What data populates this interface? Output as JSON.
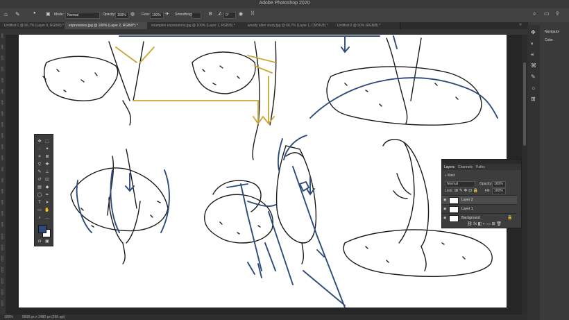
{
  "app": {
    "title": "Adobe Photoshop 2020"
  },
  "options": {
    "mode_label": "Mode:",
    "mode_value": "Normal",
    "opacity_label": "Opacity:",
    "opacity_value": "100%",
    "flow_label": "Flow:",
    "flow_value": "100%",
    "smoothing_label": "Smoothing:",
    "angle_value": "0°"
  },
  "tabs": [
    {
      "label": "Untitled-1 @ 66,7% (Layer 8, RGB/8) *"
    },
    {
      "label": "expressions.jpg @ 100% (Layer 2, RGB/8*) *"
    },
    {
      "label": "examples expressions.jpg @ 100% (Layer 1, RGB/8) *"
    },
    {
      "label": "woody allen study.jpg @ 66,7% (Layer 1, CMYK/8) *"
    },
    {
      "label": "Untitled-2 @ 50% (RGB/8) *"
    }
  ],
  "ruler_left": [
    "100",
    "150",
    "200",
    "250",
    "300",
    "350",
    "400",
    "450",
    "500",
    "550",
    "600",
    "650",
    "700",
    "750",
    "800",
    "850",
    "900",
    "950",
    "1000",
    "1050",
    "1100",
    "1150",
    "1200",
    "1250",
    "1300"
  ],
  "status": {
    "zoom": "100%",
    "doc_size": "5608 px x 2480 px (300 ppi)"
  },
  "right_panels": {
    "navigator": "Navigator",
    "color": "Color"
  },
  "layers_panel": {
    "tabs": [
      "Layers",
      "Channels",
      "Paths"
    ],
    "kind": "Kind",
    "blend": "Normal",
    "opacity_label": "Opacity:",
    "opacity_value": "100%",
    "lock_label": "Lock:",
    "fill_label": "Fill:",
    "fill_value": "100%",
    "layers": [
      {
        "name": "Layer 2",
        "selected": true
      },
      {
        "name": "Layer 1",
        "selected": false
      },
      {
        "name": "Background",
        "selected": false
      }
    ]
  },
  "colors": {
    "sketch_blue": "#2c4a7a",
    "sketch_gold": "#c9a633",
    "fg_swatch": "#2c4a7a",
    "bg_swatch": "#ffffff"
  }
}
